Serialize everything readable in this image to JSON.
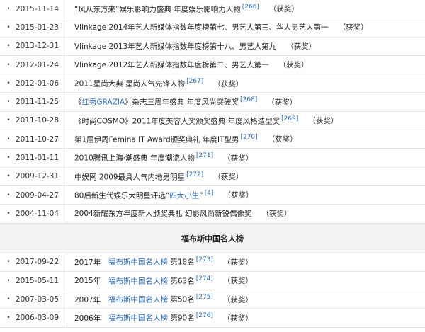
{
  "rows_top": [
    {
      "date": "2015-11-14",
      "text": "“风从东方来”娱乐影响力盛典 年度娱乐影响力人物",
      "ref": "[266]",
      "status": "（获奖）"
    },
    {
      "date": "2015-01-23",
      "text": "Vlinkage 2014年艺人新媒体指数年度榜第七、男艺人第三、华人男艺人第一",
      "ref": "",
      "status": "（获奖）"
    },
    {
      "date": "2013-12-31",
      "text": "Vlinkage 2013年艺人新媒体指数年度榜第十八、男艺人第九",
      "ref": "",
      "status": "（获奖）"
    },
    {
      "date": "2012-01-24",
      "text": "Vlinkage 2012年艺人新媒体指数年度榜第二、男艺人第一",
      "ref": "",
      "status": "（获奖）"
    },
    {
      "date": "2012-01-06",
      "text": "2011星尚大典 星尚人气先锋人物",
      "ref": "[267]",
      "status": "（获奖）"
    },
    {
      "date": "2011-11-25",
      "pre": "《",
      "link": "红秀GRAZIA",
      "text": "》杂志三周年盛典 年度风尚突破奖",
      "ref": "[268]",
      "status": "（获奖）"
    },
    {
      "date": "2011-10-28",
      "text": "《时尚COSMO》2011年度美容大奖颁奖盛典 年度风格造型奖",
      "ref": "[269]",
      "status": "（获奖）"
    },
    {
      "date": "2011-10-27",
      "text": "第1届伊周Femina IT Award颁奖典礼 年度IT型男",
      "ref": "[270]",
      "status": "（获奖）"
    },
    {
      "date": "2011-01-11",
      "text": "2010腾讯上海·潮盛典 年度潮流人物",
      "ref": "[271]",
      "status": "（获奖）"
    },
    {
      "date": "2009-12-31",
      "text": "中娱网 2009最具人气内地男明星",
      "ref": "[272]",
      "status": "（获奖）"
    },
    {
      "date": "2009-04-27",
      "text": "80后新生代娱乐大明星评选“",
      "link": "四大小生",
      "post": "”",
      "ref": "[4]",
      "status": "（获奖）"
    },
    {
      "date": "2004-11-04",
      "text": "2004新耀东方年度新人颁奖典礼 幻影风尚新锐偶像奖",
      "ref": "",
      "status": "（获奖）"
    }
  ],
  "section_title": "福布斯中国名人榜",
  "rows_bottom": [
    {
      "date": "2017-09-22",
      "year": "2017年",
      "link": "福布斯中国名人榜",
      "rank": "第18名",
      "ref": "[273]",
      "status": "（获奖）"
    },
    {
      "date": "2015-05-11",
      "year": "2015年",
      "link": "福布斯中国名人榜",
      "rank": "第63名",
      "ref": "[274]",
      "status": "（获奖）"
    },
    {
      "date": "2007-03-05",
      "year": "2007年",
      "link": "福布斯中国名人榜",
      "rank": "第50名",
      "ref": "[275]",
      "status": "（获奖）"
    },
    {
      "date": "2006-03-09",
      "year": "2006年",
      "link": "福布斯中国名人榜",
      "rank": "第90名",
      "ref": "[276]",
      "status": "（获奖）"
    }
  ]
}
